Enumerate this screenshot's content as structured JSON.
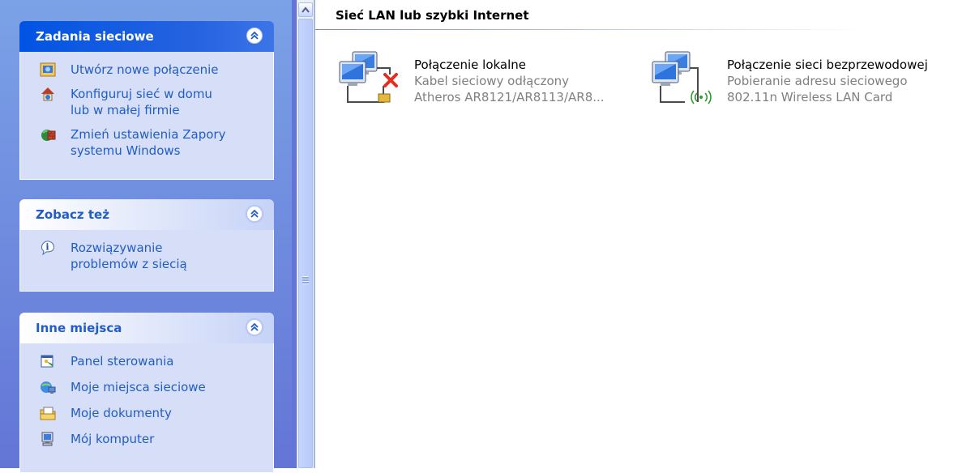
{
  "taskpane": {
    "network_tasks": {
      "title": "Zadania sieciowe",
      "items": [
        {
          "label": "Utwórz nowe połączenie",
          "icon": "new-connection-icon"
        },
        {
          "label": "Konfiguruj sieć w domu lub w małej firmie",
          "icon": "home-network-setup-icon"
        },
        {
          "label": "Zmień ustawienia Zapory systemu Windows",
          "icon": "firewall-icon"
        }
      ]
    },
    "see_also": {
      "title": "Zobacz też",
      "items": [
        {
          "label": "Rozwiązywanie problemów z siecią",
          "icon": "info-icon"
        }
      ]
    },
    "other_places": {
      "title": "Inne miejsca",
      "items": [
        {
          "label": "Panel sterowania",
          "icon": "control-panel-icon"
        },
        {
          "label": "Moje miejsca sieciowe",
          "icon": "network-places-icon"
        },
        {
          "label": "Moje dokumenty",
          "icon": "my-documents-icon"
        },
        {
          "label": "Mój komputer",
          "icon": "my-computer-icon"
        }
      ]
    },
    "collapse_symbol": "≈"
  },
  "scrollbar": {
    "up_arrow": "▲"
  },
  "main": {
    "group_title": "Sieć LAN lub szybki Internet",
    "connections": [
      {
        "name": "Połączenie lokalne",
        "status": "Kabel sieciowy odłączony",
        "device": "Atheros AR8121/AR8113/AR8...",
        "icon": "lan-disconnected-icon"
      },
      {
        "name": "Połączenie sieci bezprzewodowej",
        "status": "Pobieranie adresu sieciowego",
        "device": "802.11n Wireless LAN Card",
        "icon": "wireless-connection-icon"
      }
    ]
  },
  "colors": {
    "taskpane_bg": "#7ba2e7",
    "special_header": "#0054e3",
    "link_blue": "#215dc6",
    "panel_body": "#d6dff7"
  }
}
